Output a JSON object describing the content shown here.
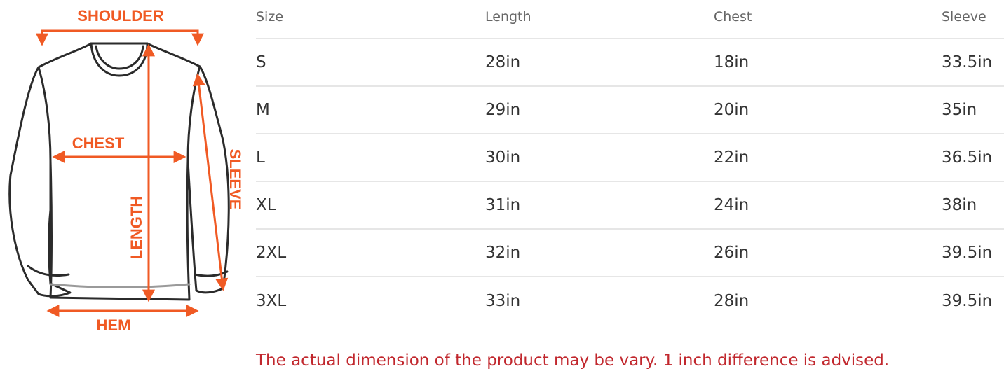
{
  "diagram": {
    "labels": {
      "shoulder": "SHOULDER",
      "chest": "CHEST",
      "length": "LENGTH",
      "sleeve": "SLEEVE",
      "hem": "HEM"
    },
    "accent_color": "#f05a24"
  },
  "table": {
    "headers": {
      "size": "Size",
      "length": "Length",
      "chest": "Chest",
      "sleeve": "Sleeve"
    },
    "rows": [
      {
        "size": "S",
        "length": "28in",
        "chest": "18in",
        "sleeve": "33.5in"
      },
      {
        "size": "M",
        "length": "29in",
        "chest": "20in",
        "sleeve": "35in"
      },
      {
        "size": "L",
        "length": "30in",
        "chest": "22in",
        "sleeve": "36.5in"
      },
      {
        "size": "XL",
        "length": "31in",
        "chest": "24in",
        "sleeve": "38in"
      },
      {
        "size": "2XL",
        "length": "32in",
        "chest": "26in",
        "sleeve": "39.5in"
      },
      {
        "size": "3XL",
        "length": "33in",
        "chest": "28in",
        "sleeve": "39.5in"
      }
    ]
  },
  "note": {
    "text": "The actual dimension of the product may be vary. 1 inch difference is advised.",
    "color": "#c1272d"
  }
}
